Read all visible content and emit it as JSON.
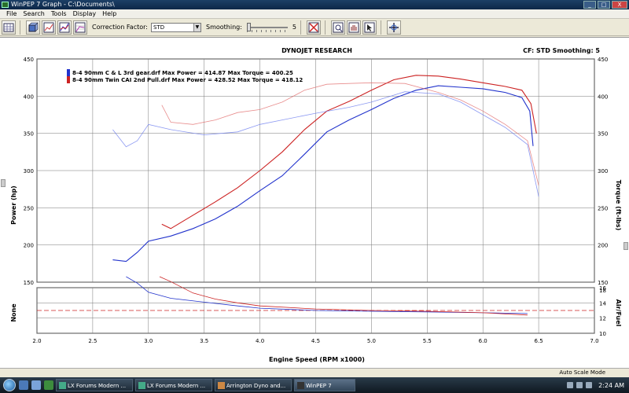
{
  "window": {
    "title": "WinPEP 7    Graph - C:\\Documents\\",
    "controls": [
      "_",
      "□",
      "X"
    ]
  },
  "menu": [
    "File",
    "Search",
    "Tools",
    "Display",
    "Help"
  ],
  "toolbar": {
    "correction_factor_label": "Correction Factor:",
    "correction_factor_value": "STD",
    "smoothing_label": "Smoothing:",
    "smoothing_value": "5"
  },
  "graph_header": {
    "title": "DYNOJET RESEARCH",
    "right": "CF: STD   Smoothing: 5"
  },
  "legend": [
    {
      "text": "8-4 90mm C & L 3rd gear.drf Max Power = 414.87 Max Torque = 400.25",
      "color": "#2233cc"
    },
    {
      "text": "8-4 90mm Twin CAI 2nd Pull.drf Max Power = 428.52 Max Torque = 418.12",
      "color": "#cc2222"
    }
  ],
  "chart_data": [
    {
      "type": "line",
      "xlabel": "Engine Speed (RPM x1000)",
      "ylabel": "Power (hp)",
      "y2label": "Torque (ft-lbs)",
      "xlim": [
        2.0,
        7.0
      ],
      "ylim": [
        150,
        450
      ],
      "y2lim": [
        150,
        450
      ],
      "x_ticks": [
        "2.0",
        "2.5",
        "3.0",
        "3.5",
        "4.0",
        "4.5",
        "5.0",
        "5.5",
        "6.0",
        "6.5",
        "7.0"
      ],
      "y_ticks": [
        "150",
        "200",
        "250",
        "300",
        "350",
        "400",
        "450"
      ],
      "y2_ticks": [
        "150",
        "200",
        "250",
        "300",
        "350",
        "400",
        "450"
      ],
      "grid": true,
      "legend_position": "top-left",
      "series": [
        {
          "name": "8-4 90mm C & L 3rd gear.drf",
          "measure": "power",
          "color": "#2233cc",
          "x": [
            2.68,
            2.8,
            2.9,
            3.0,
            3.2,
            3.4,
            3.6,
            3.8,
            4.0,
            4.2,
            4.4,
            4.6,
            4.8,
            5.0,
            5.2,
            5.4,
            5.6,
            5.8,
            6.0,
            6.2,
            6.35,
            6.42,
            6.45
          ],
          "y": [
            180,
            178,
            190,
            205,
            212,
            222,
            235,
            252,
            273,
            293,
            322,
            352,
            368,
            382,
            397,
            408,
            414,
            412,
            410,
            405,
            398,
            380,
            333
          ]
        },
        {
          "name": "8-4 90mm Twin CAI 2nd Pull.drf",
          "measure": "power",
          "color": "#cc2222",
          "x": [
            3.12,
            3.2,
            3.4,
            3.6,
            3.8,
            4.0,
            4.2,
            4.4,
            4.6,
            4.8,
            5.0,
            5.2,
            5.4,
            5.6,
            5.8,
            6.0,
            6.2,
            6.35,
            6.43,
            6.48
          ],
          "y": [
            228,
            222,
            240,
            258,
            277,
            300,
            325,
            355,
            380,
            393,
            408,
            422,
            428,
            427,
            423,
            418,
            413,
            408,
            390,
            350
          ]
        },
        {
          "name": "8-4 90mm C & L 3rd gear.drf",
          "measure": "torque",
          "color": "#6677ee",
          "x": [
            2.68,
            2.8,
            2.9,
            3.0,
            3.2,
            3.5,
            3.8,
            4.0,
            4.2,
            4.5,
            4.8,
            5.0,
            5.3,
            5.6,
            5.8,
            6.0,
            6.2,
            6.4,
            6.5
          ],
          "y": [
            355,
            332,
            340,
            362,
            355,
            348,
            352,
            362,
            368,
            377,
            385,
            392,
            406,
            403,
            392,
            375,
            358,
            335,
            265
          ]
        },
        {
          "name": "8-4 90mm Twin CAI 2nd Pull.drf",
          "measure": "torque",
          "color": "#e06666",
          "x": [
            3.12,
            3.2,
            3.4,
            3.6,
            3.8,
            4.0,
            4.2,
            4.4,
            4.6,
            4.8,
            5.0,
            5.3,
            5.6,
            5.8,
            6.0,
            6.2,
            6.4,
            6.5
          ],
          "y": [
            388,
            365,
            362,
            368,
            378,
            382,
            392,
            408,
            416,
            417,
            418,
            417,
            405,
            395,
            380,
            362,
            340,
            280
          ]
        }
      ]
    },
    {
      "type": "line",
      "xlabel": "Engine Speed (RPM x1000)",
      "ylabel": "None",
      "y2label": "Air/Fuel",
      "xlim": [
        2.0,
        7.0
      ],
      "y2lim": [
        10,
        16
      ],
      "y2_ticks": [
        "10",
        "12",
        "14",
        "16",
        "18"
      ],
      "grid": true,
      "reference_line": 13.0,
      "series": [
        {
          "name": "8-4 90mm C & L 3rd gear.drf",
          "measure": "air_fuel",
          "color": "#2233cc",
          "x": [
            2.8,
            2.9,
            3.0,
            3.2,
            3.5,
            3.8,
            4.0,
            4.5,
            5.0,
            5.5,
            6.0,
            6.4
          ],
          "y": [
            18.2,
            16.6,
            15.4,
            14.6,
            14.1,
            13.6,
            13.3,
            13.0,
            12.9,
            12.8,
            12.7,
            12.6
          ]
        },
        {
          "name": "8-4 90mm Twin CAI 2nd Pull.drf",
          "measure": "air_fuel",
          "color": "#cc2222",
          "x": [
            3.1,
            3.2,
            3.4,
            3.6,
            3.8,
            4.0,
            4.5,
            5.0,
            5.5,
            6.0,
            6.4
          ],
          "y": [
            18.2,
            16.8,
            15.3,
            14.5,
            14.0,
            13.6,
            13.2,
            13.0,
            12.9,
            12.7,
            12.4
          ]
        }
      ]
    }
  ],
  "status": {
    "auto_scale": "Auto Scale Mode"
  },
  "taskbar": {
    "tasks": [
      {
        "label": "LX Forums Modern ...",
        "active": false
      },
      {
        "label": "LX Forums Modern ...",
        "active": false
      },
      {
        "label": "Arrington Dyno and...",
        "active": false
      },
      {
        "label": "WinPEP 7",
        "active": true
      }
    ],
    "clock": "2:24 AM"
  }
}
